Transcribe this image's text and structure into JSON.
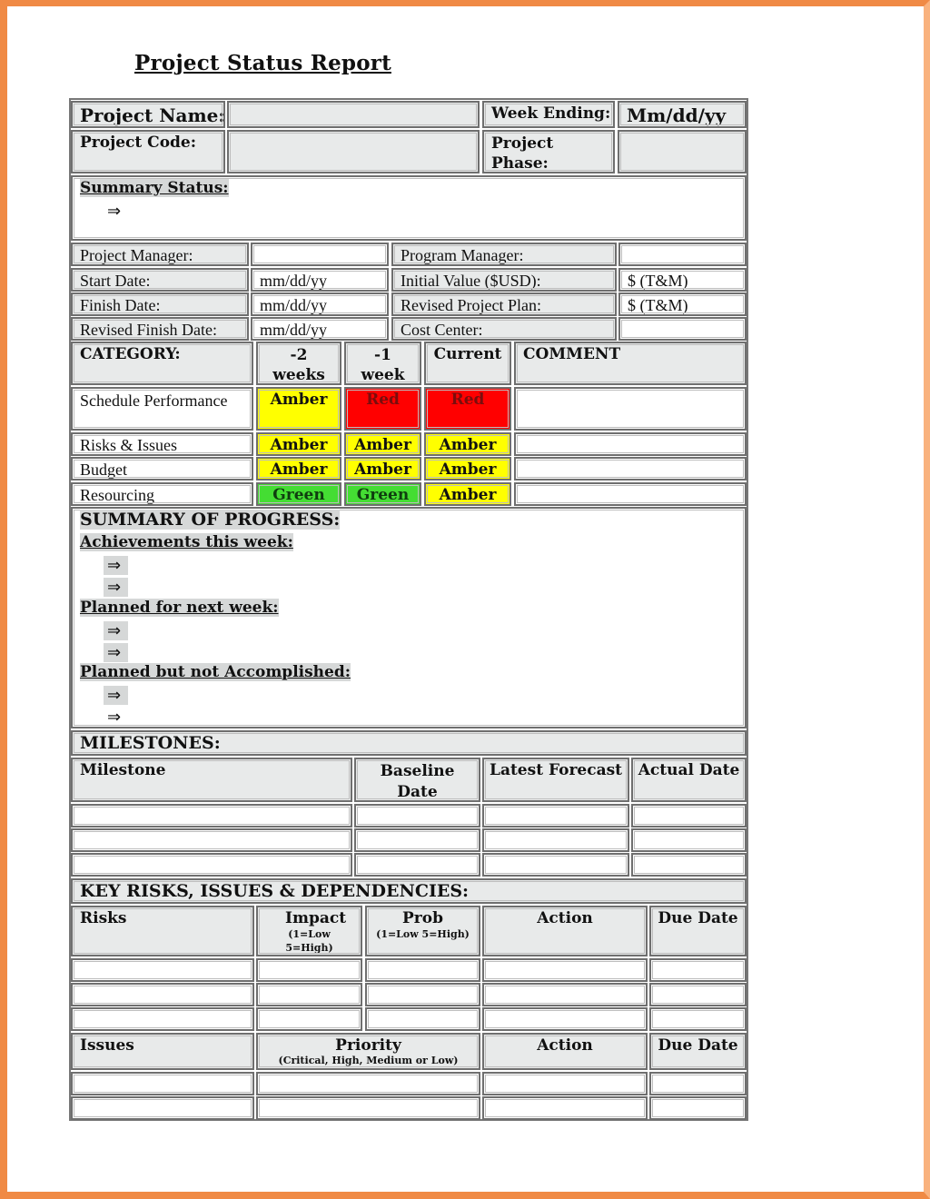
{
  "document": {
    "title": "Project Status Report"
  },
  "header": {
    "project_name_label": "Project Name:",
    "project_name_value": "",
    "week_ending_label": "Week Ending:",
    "week_ending_value": "Mm/dd/yy",
    "project_code_label": "Project Code:",
    "project_code_value": "",
    "project_phase_label": "Project Phase:",
    "project_phase_value": ""
  },
  "summary_status": {
    "label": "Summary Status:",
    "bullets": [
      "⇒"
    ]
  },
  "details": {
    "rows": [
      {
        "left_label": "Project Manager:",
        "left_value": "",
        "right_label": "Program Manager:",
        "right_value": ""
      },
      {
        "left_label": "Start Date:",
        "left_value": "mm/dd/yy",
        "right_label": "Initial Value ($USD):",
        "right_value": "$ (T&M)"
      },
      {
        "left_label": "Finish Date:",
        "left_value": "mm/dd/yy",
        "right_label": "Revised Project Plan:",
        "right_value": "$ (T&M)"
      },
      {
        "left_label": "Revised Finish Date:",
        "left_value": "mm/dd/yy",
        "right_label": "Cost Center:",
        "right_value": ""
      }
    ]
  },
  "status_table": {
    "headers": [
      "CATEGORY:",
      "-2 weeks",
      "-1 week",
      "Current",
      "COMMENT"
    ],
    "rows": [
      {
        "category": "Schedule Performance",
        "minus2": "Amber",
        "minus1": "Red",
        "current": "Red",
        "comment": ""
      },
      {
        "category": "Risks & Issues",
        "minus2": "Amber",
        "minus1": "Amber",
        "current": "Amber",
        "comment": ""
      },
      {
        "category": "Budget",
        "minus2": "Amber",
        "minus1": "Amber",
        "current": "Amber",
        "comment": ""
      },
      {
        "category": "Resourcing",
        "minus2": "Green",
        "minus1": "Green",
        "current": "Amber",
        "comment": ""
      }
    ],
    "colors": {
      "Amber": "#ffff00",
      "Red": "#ff0000",
      "Green": "#44dd33"
    }
  },
  "progress": {
    "heading": "SUMMARY OF PROGRESS:",
    "achievements_label": "Achievements this week:",
    "achievements": [
      "⇒",
      "⇒"
    ],
    "planned_label": "Planned for next week:",
    "planned": [
      "⇒",
      "⇒"
    ],
    "not_accomplished_label": "Planned but not Accomplished:",
    "not_accomplished": [
      "⇒",
      "⇒"
    ]
  },
  "milestones": {
    "heading": "MILESTONES:",
    "headers": [
      "Milestone",
      "Baseline Date",
      "Latest Forecast",
      "Actual Date"
    ],
    "rows": [
      [
        "",
        "",
        "",
        ""
      ],
      [
        "",
        "",
        "",
        ""
      ],
      [
        "",
        "",
        "",
        ""
      ]
    ]
  },
  "risks": {
    "heading": "KEY RISKS, ISSUES & DEPENDENCIES:",
    "headers": {
      "risks": "Risks",
      "impact": "Impact",
      "impact_note": "(1=Low 5=High)",
      "prob": "Prob",
      "prob_note": "(1=Low 5=High)",
      "action": "Action",
      "due_date": "Due Date"
    },
    "rows": [
      [
        "",
        "",
        "",
        "",
        ""
      ],
      [
        "",
        "",
        "",
        "",
        ""
      ],
      [
        "",
        "",
        "",
        "",
        ""
      ]
    ]
  },
  "issues": {
    "headers": {
      "issues": "Issues",
      "priority": "Priority",
      "priority_note": "(Critical, High, Medium or Low)",
      "action": "Action",
      "due_date": "Due Date"
    },
    "rows": [
      [
        "",
        "",
        "",
        ""
      ],
      [
        "",
        "",
        "",
        ""
      ]
    ]
  }
}
